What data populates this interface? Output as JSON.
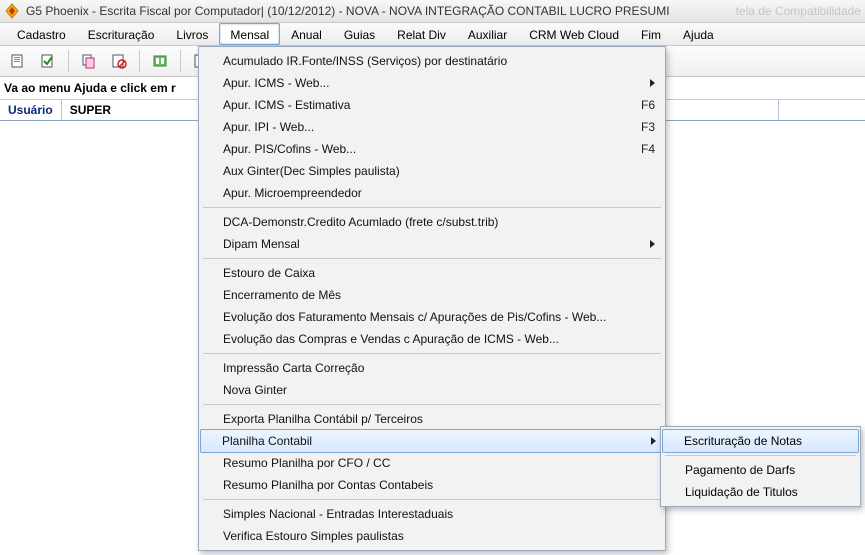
{
  "window": {
    "title": "G5 Phoenix - Escrita Fiscal por Computador| (10/12/2012) - NOVA - NOVA INTEGRAÇÃO CONTABIL LUCRO PRESUMI",
    "faded_right": "tela de Compatibilidade"
  },
  "menubar": {
    "items": [
      "Cadastro",
      "Escrituração",
      "Livros",
      "Mensal",
      "Anual",
      "Guias",
      "Relat Div",
      "Auxiliar",
      "CRM Web Cloud",
      "Fim",
      "Ajuda"
    ],
    "open_index": 3
  },
  "hint": "Va ao menu Ajuda e click em r",
  "status": {
    "label": "Usuário",
    "value": "SUPER"
  },
  "dropdown": {
    "groups": [
      [
        {
          "label": "Acumulado IR.Fonte/INSS (Serviços) por destinatário"
        },
        {
          "label": "Apur. ICMS - Web...",
          "submenu": true
        },
        {
          "label": "Apur. ICMS - Estimativa",
          "shortcut": "F6"
        },
        {
          "label": "Apur. IPI - Web...",
          "shortcut": "F3"
        },
        {
          "label": "Apur. PIS/Cofins - Web...",
          "shortcut": "F4"
        },
        {
          "label": "Aux Ginter(Dec Simples paulista)"
        },
        {
          "label": "Apur. Microempreendedor"
        }
      ],
      [
        {
          "label": "DCA-Demonstr.Credito Acumlado (frete c/subst.trib)"
        },
        {
          "label": "Dipam Mensal",
          "submenu": true
        }
      ],
      [
        {
          "label": "Estouro de Caixa"
        },
        {
          "label": "Encerramento de Mês"
        },
        {
          "label": "Evolução dos Faturamento Mensais c/ Apurações de Pis/Cofins - Web..."
        },
        {
          "label": "Evolução das Compras e Vendas c Apuração de ICMS - Web..."
        }
      ],
      [
        {
          "label": "Impressão Carta Correção"
        },
        {
          "label": "Nova Ginter"
        }
      ],
      [
        {
          "label": "Exporta Planilha Contábil p/ Terceiros"
        },
        {
          "label": "Planilha Contabil",
          "submenu": true,
          "highlight": true
        },
        {
          "label": "Resumo Planilha por CFO / CC"
        },
        {
          "label": "Resumo Planilha por Contas Contabeis"
        }
      ],
      [
        {
          "label": "Simples Nacional - Entradas Interestaduais"
        },
        {
          "label": "Verifica Estouro Simples paulistas"
        }
      ]
    ]
  },
  "submenu": {
    "groups": [
      [
        {
          "label": "Escrituração de Notas",
          "highlight": true
        }
      ],
      [
        {
          "label": "Pagamento de Darfs"
        },
        {
          "label": "Liquidação de Titulos"
        }
      ]
    ]
  }
}
